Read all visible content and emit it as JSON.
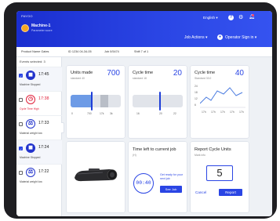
{
  "header": {
    "brand": "PAYOO",
    "machine_name": "Machine-1",
    "machine_subtitle": "Parameter score",
    "language": "English",
    "job_actions": "Job Actions",
    "operator": "Operator Sign in",
    "accent": "#2a45e4"
  },
  "infobar": {
    "items": [
      "Product Name Gates",
      "ID 1234 04-34-05",
      "Job 0/5474",
      "Shift 7 of 1"
    ]
  },
  "sidebar": {
    "title": "Events selected: 3",
    "events": [
      {
        "time": "17:45",
        "label": "Machine Stopped",
        "icon": "stop-icon",
        "checked": true,
        "color": "blue"
      },
      {
        "time": "17:38",
        "label": "Cycle Time High",
        "icon": "clock-alert-icon",
        "checked": false,
        "color": "red"
      },
      {
        "time": "17:33",
        "label": "Material weight low",
        "icon": "scale-icon",
        "checked": false,
        "color": "gray"
      },
      {
        "time": "17:24",
        "label": "Machine Stopped",
        "icon": "stop-icon",
        "checked": true,
        "color": "blue"
      },
      {
        "time": "17:22",
        "label": "Material weight low",
        "icon": "scale-icon",
        "checked": false,
        "color": "gray"
      }
    ]
  },
  "cards": {
    "units_made": {
      "title": "Units made",
      "subtitle": "standard 40",
      "value": "700",
      "ticks": [
        "0",
        "700",
        "17k",
        "3k"
      ],
      "fill_fraction": 0.42
    },
    "cycle_time": {
      "title": "Cycle time",
      "subtitle": "standard 18",
      "value": "20",
      "ticks": [
        "16",
        "20",
        "22"
      ],
      "fill_fraction": 0.55
    },
    "cycle_time_trend": {
      "title": "Cycle time",
      "subtitle": "Standard 33.0",
      "value": "40",
      "y_ticks": [
        "24",
        "18",
        "12",
        "6"
      ],
      "x_ticks": [
        "17h",
        "17h",
        "17h",
        "17h",
        "17h"
      ]
    },
    "time_left": {
      "title": "Time left to current job",
      "subtitle": "(H)",
      "value": "00:40",
      "note": "Get ready for your next job",
      "button": "See Job"
    },
    "report_units": {
      "title": "Report Cycle Units",
      "subtitle": "Mark info",
      "value": "5",
      "cancel": "Cancel",
      "submit": "Report"
    }
  }
}
